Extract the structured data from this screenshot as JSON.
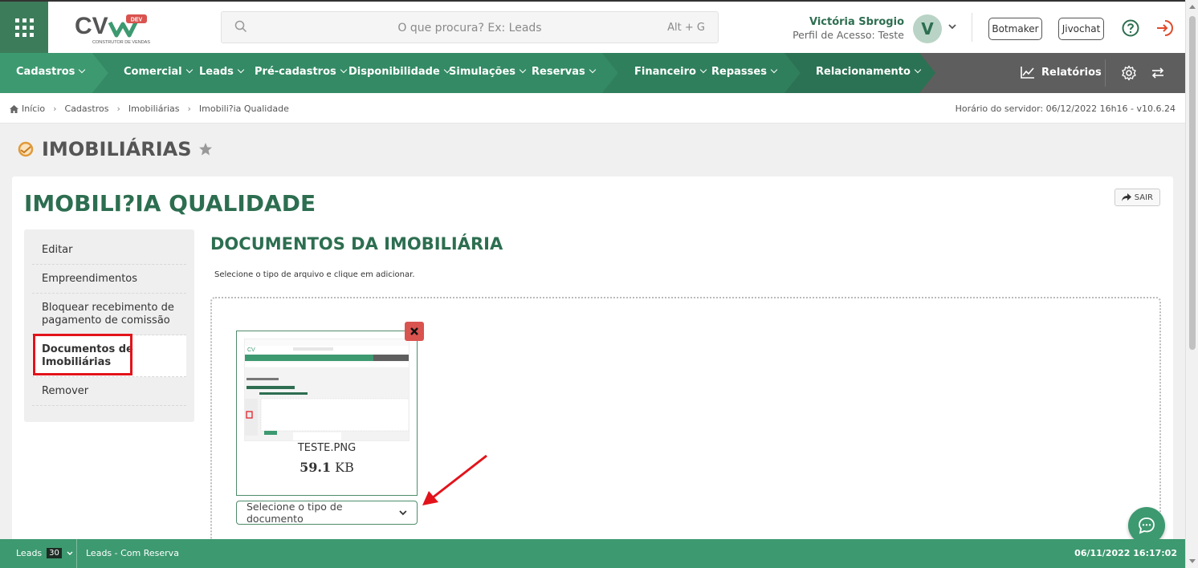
{
  "header": {
    "logo_text": "CV",
    "logo_badge": "DEV",
    "logo_tagline": "CONSTRUTOR DE VENDAS",
    "search_placeholder": "O que procura? Ex: Leads",
    "search_shortcut": "Alt + G",
    "user_name": "Victória Sbrogio",
    "user_profile": "Perfil de Acesso: Teste",
    "avatar_initial": "V",
    "botmaker_label": "Botmaker",
    "jivochat_label": "Jivochat"
  },
  "nav": {
    "items": [
      {
        "label": "Cadastros"
      },
      {
        "label": "Comercial"
      },
      {
        "label": "Leads"
      },
      {
        "label": "Pré-cadastros"
      },
      {
        "label": "Disponibilidade"
      },
      {
        "label": "Simulações"
      },
      {
        "label": "Reservas"
      },
      {
        "label": "Financeiro"
      },
      {
        "label": "Repasses"
      },
      {
        "label": "Relacionamento"
      }
    ],
    "reports_label": "Relatórios"
  },
  "breadcrumb": {
    "items": [
      "Início",
      "Cadastros",
      "Imobiliárias",
      "Imobili?ia Qualidade"
    ],
    "server_time": "Horário do servidor: 06/12/2022 16h16 - v10.6.24"
  },
  "page": {
    "title": "IMOBILIÁRIAS",
    "record_title": "IMOBILI?IA QUALIDADE",
    "exit_label": "SAIR"
  },
  "side_menu": {
    "items": [
      {
        "label": "Editar"
      },
      {
        "label": "Empreendimentos"
      },
      {
        "label": "Bloquear recebimento de pagamento de comissão"
      },
      {
        "label": "Documentos de Imobiliárias"
      },
      {
        "label": "Remover"
      }
    ]
  },
  "documents": {
    "section_title": "DOCUMENTOS DA IMOBILIÁRIA",
    "hint": "Selecione o tipo de arquivo e clique em adicionar.",
    "file_name": "TESTE.PNG",
    "file_size_value": "59.1",
    "file_size_unit": "KB",
    "type_select_value": "Selecione o tipo de documento"
  },
  "footer": {
    "leads_label": "Leads",
    "leads_count": "30",
    "status": "Leads - Com Reserva",
    "datetime": "06/11/2022 16:17:02"
  },
  "colors": {
    "brand_green": "#3d7c5a",
    "title_green": "#2d6e50",
    "footer_green": "#3d9970",
    "nav_gray": "#5e5e5e",
    "highlight_red": "#e3131b",
    "delete_red": "#d9534f"
  }
}
